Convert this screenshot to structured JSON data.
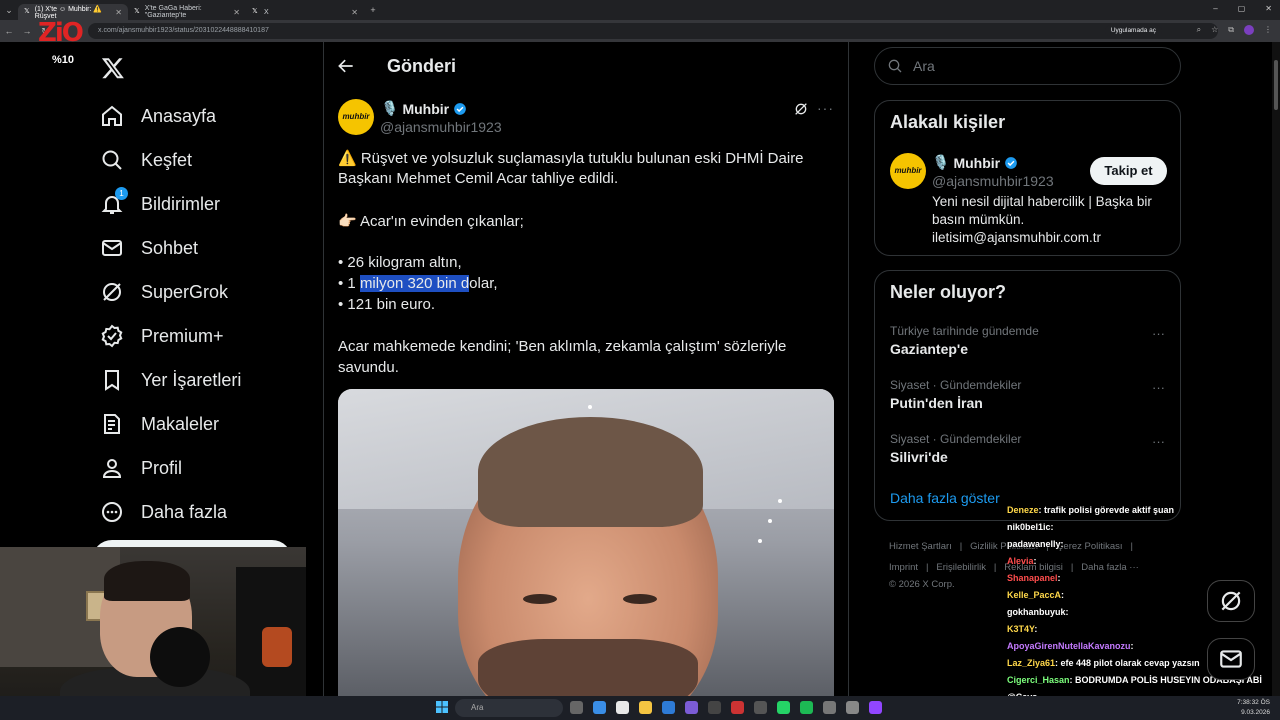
{
  "browser": {
    "tabs": [
      {
        "label": "(1) X'te ☺ Muhbir: ⚠️ Rüşvet",
        "active": true
      },
      {
        "label": "X'te GaGa Haberi: \"Gaziantep'te",
        "active": false
      },
      {
        "label": "X",
        "active": false
      }
    ],
    "url": "x.com/ajansmuhbir1923/status/2031022448888410187",
    "open_app_label": "Uygulamada aç"
  },
  "overlay_logo": {
    "text": "ZiO",
    "percent": "%10"
  },
  "nav": {
    "items": [
      {
        "label": "Anasayfa",
        "icon": "home-icon"
      },
      {
        "label": "Keşfet",
        "icon": "search-icon"
      },
      {
        "label": "Bildirimler",
        "icon": "bell-icon",
        "badge": "1"
      },
      {
        "label": "Sohbet",
        "icon": "mail-icon"
      },
      {
        "label": "SuperGrok",
        "icon": "grok-icon"
      },
      {
        "label": "Premium+",
        "icon": "premium-icon"
      },
      {
        "label": "Yer İşaretleri",
        "icon": "bookmark-icon"
      },
      {
        "label": "Makaleler",
        "icon": "article-icon"
      },
      {
        "label": "Profil",
        "icon": "profile-icon"
      },
      {
        "label": "Daha fazla",
        "icon": "more-circle-icon"
      }
    ]
  },
  "post": {
    "page_title": "Gönderi",
    "avatar_text": "muhbir",
    "author_name": "Muhbir",
    "author_handle": "@ajansmuhbir1923",
    "lines": [
      "⚠️ Rüşvet ve yolsuzluk suçlamasıyla tutuklu bulunan eski DHMİ Daire",
      "Başkanı Mehmet Cemil Acar tahliye edildi.",
      "👉🏻 Acar'ın evinden çıkanlar;",
      "• 26 kilogram altın,",
      "• 1 ",
      "milyon 320 bin d",
      "olar,",
      "• 121 bin euro.",
      "Acar mahkemede kendini; 'Ben aklımla, zekamla çalıştım' sözleriyle",
      "savundu."
    ]
  },
  "search": {
    "placeholder": "Ara"
  },
  "relevant": {
    "title": "Alakalı kişiler",
    "avatar_text": "muhbir",
    "name": "Muhbir",
    "handle": "@ajansmuhbir1923",
    "follow_label": "Takip et",
    "bio": [
      "Yeni nesil dijital habercilik | Başka bir",
      "basın mümkün.",
      "iletisim@ajansmuhbir.com.tr"
    ]
  },
  "trends": {
    "title": "Neler oluyor?",
    "items": [
      {
        "category": "Türkiye tarihinde gündemde",
        "name": "Gaziantep'e"
      },
      {
        "category": "Siyaset · Gündemdekiler",
        "name": "Putin'den İran"
      },
      {
        "category": "Siyaset · Gündemdekiler",
        "name": "Silivri'de"
      }
    ],
    "show_more": "Daha fazla göster"
  },
  "footer": {
    "row1": [
      "Hizmet Şartları",
      "|",
      "Gizlilik Politikası",
      "|",
      "Çerez Politikası",
      "|"
    ],
    "row2": [
      "Imprint",
      "|",
      "Erişilebilirlik",
      "|",
      "Reklam bilgisi",
      "|",
      "Daha fazla ···"
    ],
    "copyright": "© 2026 X Corp."
  },
  "chat": [
    {
      "user": "Deneze",
      "color": "#ffd84a",
      "msg": ": trafik polisi görevde aktif şuan"
    },
    {
      "user": "nik0bel1ic",
      "color": "#ffffff",
      "msg": ":"
    },
    {
      "user": "padawanelly",
      "color": "#ffffff",
      "msg": ":"
    },
    {
      "user": "Alevia",
      "color": "#ff4d4d",
      "msg": ":"
    },
    {
      "user": "Shanapanel",
      "color": "#ff4d4d",
      "msg": ":"
    },
    {
      "user": "Kelle_PaccA",
      "color": "#ffd84a",
      "msg": ":"
    },
    {
      "user": "gokhanbuyuk",
      "color": "#ffffff",
      "msg": ":"
    },
    {
      "user": "K3T4Y",
      "color": "#ffd84a",
      "msg": ":"
    },
    {
      "user": "ApoyaGirenNutellaKavanozu",
      "color": "#c57bff",
      "msg": ":"
    },
    {
      "user": "Laz_Ziya61",
      "color": "#ffd84a",
      "msg": ": efe 448 pilot olarak cevap yazsın"
    },
    {
      "user": "Cigerci_Hasan",
      "color": "#7dff7d",
      "msg": ": BODRUMDA POLİS HUSEYIN ODABAŞI ABİ"
    },
    {
      "user": "@Cavs",
      "color": "#ffffff",
      "msg": ""
    }
  ],
  "taskbar": {
    "search_placeholder": "Ara",
    "time": "7:38:32 ÖS",
    "date": "9.03.2026"
  },
  "colors": {
    "accent": "#1d9bf0",
    "muhbir_yellow": "#f5c400",
    "highlight": "#1e4fc2"
  }
}
